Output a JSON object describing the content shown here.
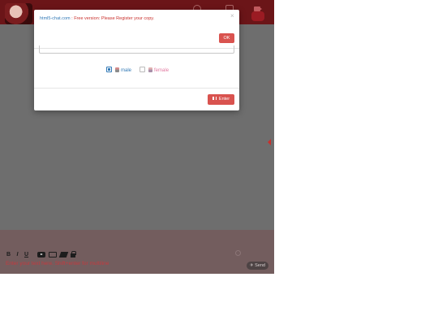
{
  "modal": {
    "notice_link": "html5-chat.com",
    "notice_text": " : Free version: Please Register your copy.",
    "ok_label": "OK",
    "close_glyph": "×",
    "gender_options": [
      {
        "label": "male",
        "checked": true
      },
      {
        "label": "female",
        "checked": false
      }
    ],
    "enter_label": "Enter"
  },
  "chat": {
    "input_placeholder": "Enter your text here. Shift+enter for multiline",
    "send_label": "Send"
  },
  "toolbar": {
    "bold": "B",
    "italic": "I",
    "underline": "U",
    "icons": [
      "bold-icon",
      "italic-icon",
      "underline-icon",
      "youtube-icon",
      "image-icon",
      "eraser-icon",
      "lock-icon"
    ]
  },
  "colors": {
    "accent": "#d9534f",
    "header": "#6b1518",
    "link": "#337ab7",
    "female": "#e27aa1"
  }
}
